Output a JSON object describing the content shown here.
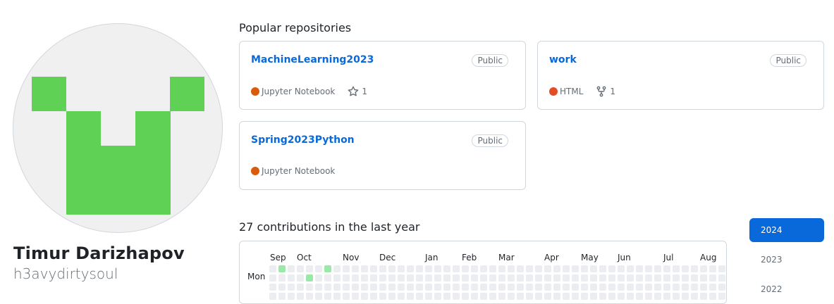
{
  "profile": {
    "fullname": "Timur Darizhapov",
    "login": "h3avydirtysoul",
    "avatar_color": "#5fd154"
  },
  "popular": {
    "title": "Popular repositories",
    "repos": [
      {
        "name": "MachineLearning2023",
        "visibility": "Public",
        "language": "Jupyter Notebook",
        "language_color": "#DA5B0B",
        "stat_icon": "star-icon",
        "stat": "1"
      },
      {
        "name": "work",
        "visibility": "Public",
        "language": "HTML",
        "language_color": "#e34c26",
        "stat_icon": "fork-icon",
        "stat": "1"
      },
      {
        "name": "Spring2023Python",
        "visibility": "Public",
        "language": "Jupyter Notebook",
        "language_color": "#DA5B0B"
      }
    ]
  },
  "contributions": {
    "title": "27 contributions in the last year",
    "months": [
      "Sep",
      "Oct",
      "Nov",
      "Dec",
      "Jan",
      "Feb",
      "Mar",
      "Apr",
      "May",
      "Jun",
      "Jul",
      "Aug"
    ],
    "day_label": "Mon",
    "empty_color": "#ebedf0",
    "level1_color": "#9be9a8"
  },
  "years": [
    "2024",
    "2023",
    "2022"
  ]
}
